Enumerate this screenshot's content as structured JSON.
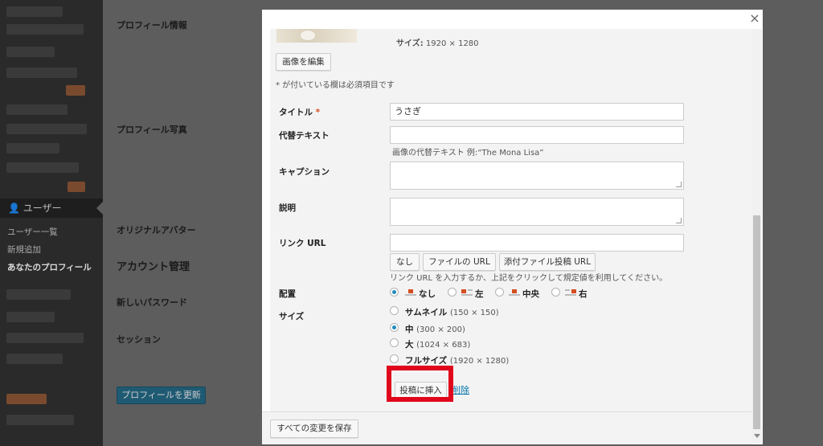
{
  "sidebar": {
    "users_menu_label": "ユーザー",
    "submenu": [
      {
        "label": "ユーザー一覧"
      },
      {
        "label": "新規追加"
      },
      {
        "label": "あなたのプロフィール"
      }
    ]
  },
  "background": {
    "profile_info_label": "プロフィール情報",
    "profile_photo_label": "プロフィール写真",
    "original_avatar_label": "オリジナルアバター",
    "account_heading": "アカウント管理",
    "new_password_label": "新しいパスワード",
    "session_label": "セッション",
    "update_button_label": "プロフィールを更新"
  },
  "modal": {
    "close_label": "×",
    "size_info_label": "サイズ:",
    "size_info_value": "1920 × 1280",
    "edit_image_label": "画像を編集",
    "required_note": "* が付いている欄は必須項目です",
    "fields": {
      "title_label": "タイトル",
      "required_mark": "*",
      "title_value": "うさぎ",
      "alt_label": "代替テキスト",
      "alt_value": "",
      "alt_hint": "画像の代替テキスト 例:“The Mona Lisa”",
      "caption_label": "キャプション",
      "description_label": "説明",
      "link_label": "リンク URL",
      "link_value": ""
    },
    "link_buttons": [
      {
        "label": "なし"
      },
      {
        "label": "ファイルの URL"
      },
      {
        "label": "添付ファイル投稿 URL"
      }
    ],
    "link_hint": "リンク URL を入力するか、上記をクリックして規定値を利用してください。",
    "align": {
      "label": "配置",
      "options": [
        {
          "label": "なし",
          "checked": true,
          "icon": "align-none-icon"
        },
        {
          "label": "左",
          "checked": false,
          "icon": "align-left-icon"
        },
        {
          "label": "中央",
          "checked": false,
          "icon": "align-center-icon"
        },
        {
          "label": "右",
          "checked": false,
          "icon": "align-right-icon"
        }
      ]
    },
    "size": {
      "label": "サイズ",
      "options": [
        {
          "label": "サムネイル",
          "dims": "(150 × 150)",
          "checked": false
        },
        {
          "label": "中",
          "dims": "(300 × 200)",
          "checked": true
        },
        {
          "label": "大",
          "dims": "(1024 × 683)",
          "checked": false
        },
        {
          "label": "フルサイズ",
          "dims": "(1920 × 1280)",
          "checked": false
        }
      ]
    },
    "insert_button_label": "投稿に挿入",
    "delete_link_label": "削除",
    "save_all_label": "すべての変更を保存"
  },
  "colors": {
    "accent": "#1e8cbe",
    "highlight": "#e0061c",
    "required": "#d54e21"
  }
}
